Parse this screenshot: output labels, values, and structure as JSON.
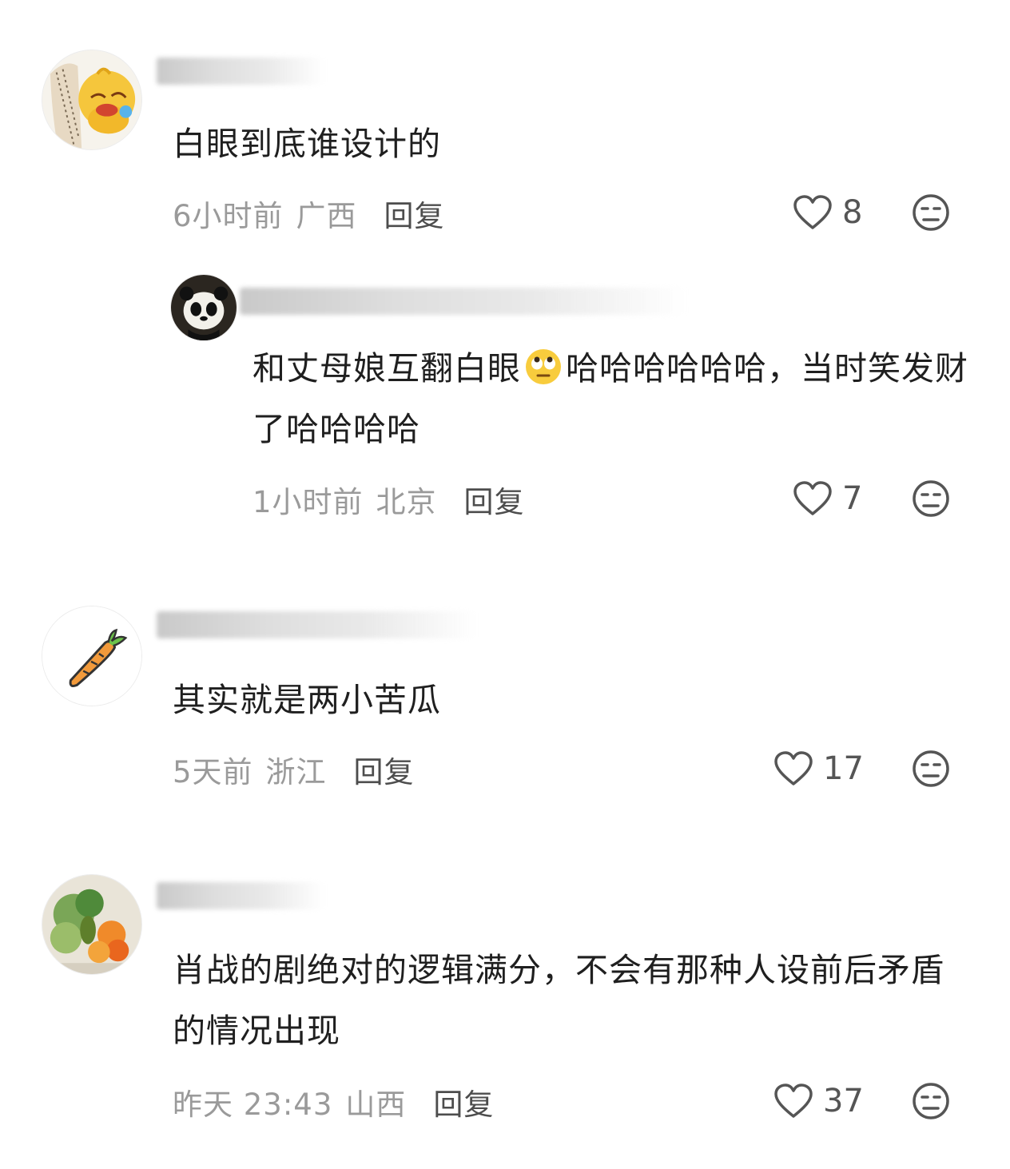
{
  "comments": [
    {
      "avatar_icon": "duck-sticker-avatar-icon",
      "text": "白眼到底谁设计的",
      "time": "6小时前",
      "location": "广西",
      "reply_label": "回复",
      "likes": "8"
    },
    {
      "avatar_icon": "panda-avatar-icon",
      "text_before_emoji": "和丈母娘互翻白眼",
      "emoji": "rolling-eyes-emoji",
      "text_after_emoji": "哈哈哈哈哈哈，当时笑发财了哈哈哈哈",
      "time": "1小时前",
      "location": "北京",
      "reply_label": "回复",
      "likes": "7"
    },
    {
      "avatar_icon": "carrot-avatar-icon",
      "text": "其实就是两小苦瓜",
      "time": "5天前",
      "location": "浙江",
      "reply_label": "回复",
      "likes": "17"
    },
    {
      "avatar_icon": "vegetables-avatar-icon",
      "text": "肖战的剧绝对的逻辑满分，不会有那种人设前后矛盾的情况出现",
      "time": "昨天 23:43",
      "location": "山西",
      "reply_label": "回复",
      "likes": "37"
    }
  ],
  "icons": {
    "like": "heart-outline-icon",
    "dislike": "unamused-face-icon"
  },
  "colors": {
    "text": "#1f1f1f",
    "meta": "#9a9a9a",
    "reply": "#4d4d4d",
    "icon": "#555555"
  }
}
